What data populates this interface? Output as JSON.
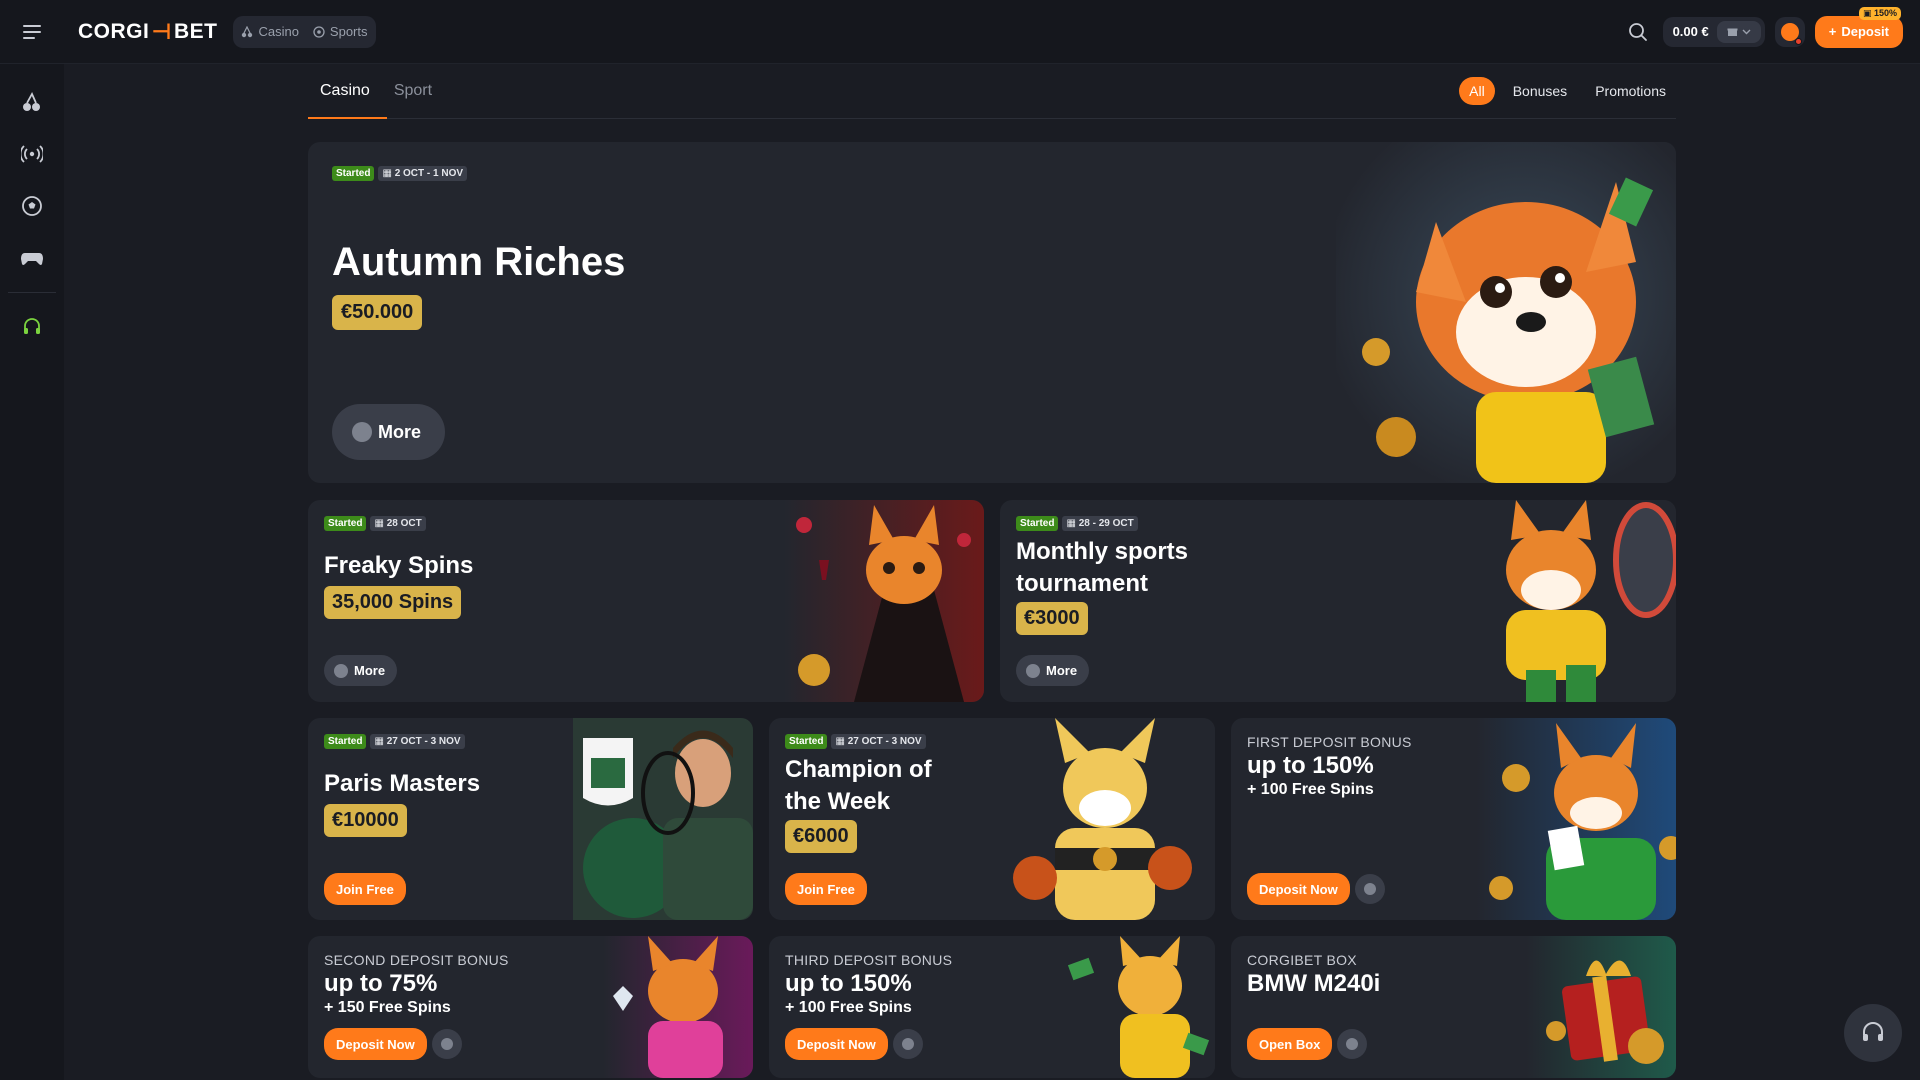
{
  "header": {
    "brand_left": "CORGI",
    "brand_mark": "⊣",
    "brand_right": "BET",
    "modes": [
      {
        "label": "Casino",
        "icon": "cherry-icon"
      },
      {
        "label": "Sports",
        "icon": "soccer-ball-icon"
      }
    ],
    "balance": "0.00 €",
    "deposit_label": "Deposit",
    "deposit_badge": "150%"
  },
  "sidebar": {
    "items": [
      {
        "icon": "cherries-icon"
      },
      {
        "icon": "live-broadcast-icon"
      },
      {
        "icon": "soccer-ball-icon"
      },
      {
        "icon": "gamepad-icon"
      },
      {
        "icon": "headset-icon"
      }
    ]
  },
  "tabs": {
    "casino": "Casino",
    "sport": "Sport"
  },
  "filters": {
    "all": "All",
    "bonuses": "Bonuses",
    "promotions": "Promotions"
  },
  "cards": {
    "autumn": {
      "status": "Started",
      "date": "2 OCT - 1 NOV",
      "title": "Autumn Riches",
      "prize": "€50.000",
      "button": "More"
    },
    "freaky": {
      "status": "Started",
      "date": "28 OCT",
      "title": "Freaky Spins",
      "prize": "35,000 Spins",
      "button": "More"
    },
    "monthly": {
      "status": "Started",
      "date": "28 - 29 OCT",
      "title_line1": "Monthly sports",
      "title_line2": "tournament",
      "prize": "€3000",
      "button": "More"
    },
    "paris": {
      "status": "Started",
      "date": "27 OCT - 3 NOV",
      "title": "Paris Masters",
      "prize": "€10000",
      "button": "Join Free"
    },
    "champion": {
      "status": "Started",
      "date": "27 OCT - 3 NOV",
      "title_line1": "Champion of",
      "title_line2": "the Week",
      "prize": "€6000",
      "button": "Join Free"
    },
    "first_deposit": {
      "label": "FIRST DEPOSIT BONUS",
      "headline": "up to 150%",
      "sub": "+ 100 Free Spins",
      "button": "Deposit Now"
    },
    "second_deposit": {
      "label": "SECOND DEPOSIT BONUS",
      "headline": "up to 75%",
      "sub": "+ 150 Free Spins",
      "button": "Deposit Now"
    },
    "third_deposit": {
      "label": "THIRD DEPOSIT BONUS",
      "headline": "up to 150%",
      "sub": "+ 100 Free Spins",
      "button": "Deposit Now"
    },
    "corgibet_box": {
      "label": "CORGIBET BOX",
      "headline": "BMW M240i",
      "button": "Open Box"
    }
  },
  "colors": {
    "accent": "#ff7a1a",
    "prize_gold": "#d9b44a",
    "started_green": "#3d8b1a",
    "background": "#1a1c23",
    "card": "#23262e"
  }
}
